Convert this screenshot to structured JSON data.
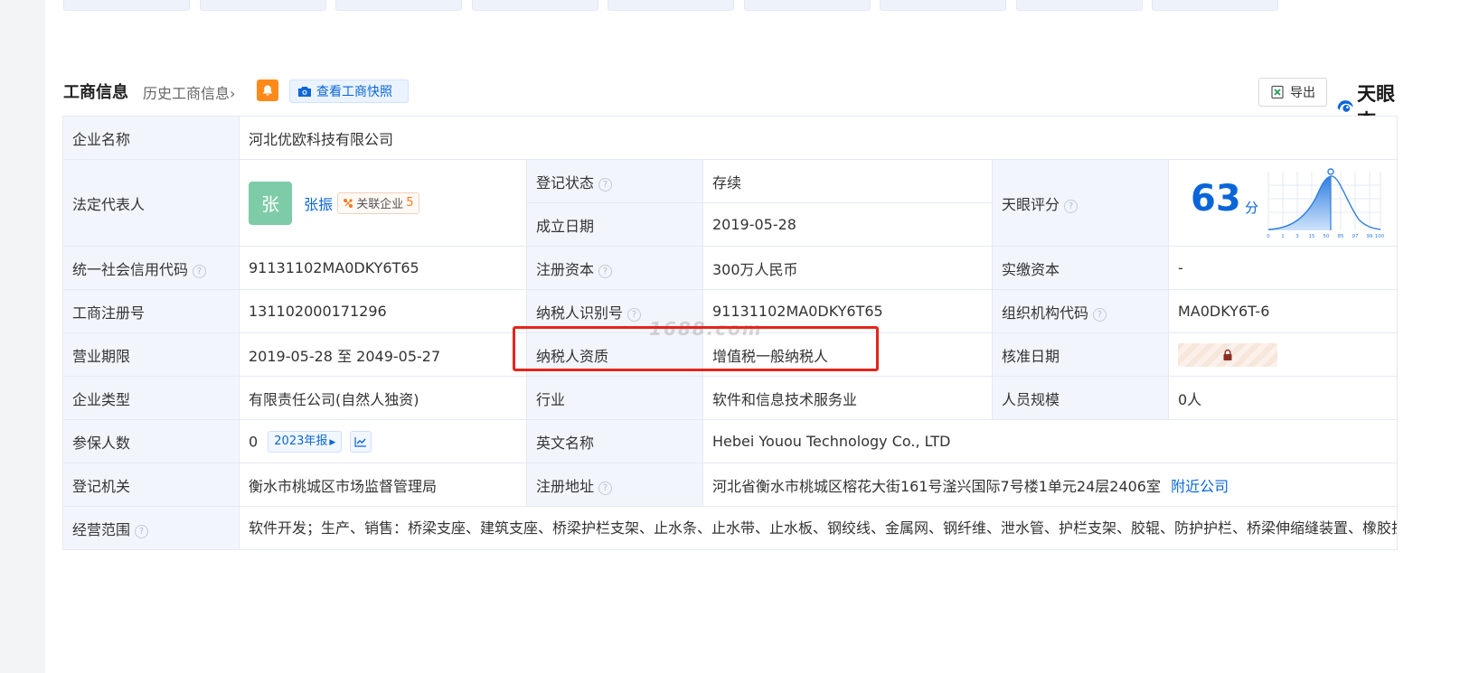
{
  "header": {
    "title": "工商信息",
    "history": "历史工商信息",
    "history_chevron": "›",
    "snapshot": "查看工商快照",
    "export": "导出",
    "brand": "天眼查"
  },
  "rows": {
    "company_name": {
      "label": "企业名称",
      "value": "河北优欧科技有限公司"
    },
    "legal_rep": {
      "label": "法定代表人",
      "avatar": "张",
      "name": "张振",
      "related_label": "关联企业",
      "related_count": "5"
    },
    "reg_status": {
      "label": "登记状态",
      "value": "存续"
    },
    "established": {
      "label": "成立日期",
      "value": "2019-05-28"
    },
    "score": {
      "label": "天眼评分",
      "value": "63",
      "unit": "分",
      "axis": [
        "0",
        "1",
        "3",
        "15",
        "50",
        "85",
        "97",
        "99",
        "100"
      ]
    },
    "credit_code": {
      "label": "统一社会信用代码",
      "value": "91131102MA0DKY6T65"
    },
    "reg_capital": {
      "label": "注册资本",
      "value": "300万人民币"
    },
    "paid_capital": {
      "label": "实缴资本",
      "value": "-"
    },
    "reg_no": {
      "label": "工商注册号",
      "value": "131102000171296"
    },
    "taxpayer_id": {
      "label": "纳税人识别号",
      "value": "91131102MA0DKY6T65"
    },
    "org_code": {
      "label": "组织机构代码",
      "value": "MA0DKY6T-6"
    },
    "term": {
      "label": "营业期限",
      "value": "2019-05-28 至 2049-05-27"
    },
    "taxpayer_type": {
      "label": "纳税人资质",
      "value": "增值税一般纳税人"
    },
    "approval_date": {
      "label": "核准日期"
    },
    "company_type": {
      "label": "企业类型",
      "value": "有限责任公司(自然人独资)"
    },
    "industry": {
      "label": "行业",
      "value": "软件和信息技术服务业"
    },
    "staff_size": {
      "label": "人员规模",
      "value": "0人"
    },
    "insured": {
      "label": "参保人数",
      "value": "0",
      "report": "2023年报"
    },
    "english_name": {
      "label": "英文名称",
      "value": "Hebei Youou Technology Co., LTD"
    },
    "authority": {
      "label": "登记机关",
      "value": "衡水市桃城区市场监督管理局"
    },
    "address": {
      "label": "注册地址",
      "value": "河北省衡水市桃城区榕花大街161号滏兴国际7号楼1单元24层2406室",
      "nearby": "附近公司"
    },
    "scope": {
      "label": "经营范围",
      "value": "软件开发；生产、销售：桥梁支座、建筑支座、桥梁护栏支架、止水条、止水带、止水板、钢绞线、金属网、钢纤维、泄水管、护栏支架、胶辊、防护护栏、桥梁伸缩缝装置、橡胶护舷、橡胶气囊、闭孔泡沫板、橡胶充气芯模、路拱、防水材料（不含沥青）、防火材料、声屏障、电缆托架、土工材料、锚具、阻尼器、双组份密封胶、双组份聚硫密封膏、钢波纹涵管、声测管；钢波纹涵管、防落梁装置、防震锚栓、支座配套钢板、梁底钢板的安装与维护；预应力锚具的研发、生产、销售；防火工程、防水工程、路桥养护工程设计及施工；国内贸易代理服务；货物或技术进出口（国家禁止或涉及行政审批的货物和技术进出口除外）。（依法须经批准的项目，经相关部门批准后方可开展经营活动）"
    }
  },
  "watermark": "1688.com",
  "colors": {
    "accent": "#0a66d8",
    "status_green": "#1a9a52",
    "highlight_red": "#e5251c"
  }
}
